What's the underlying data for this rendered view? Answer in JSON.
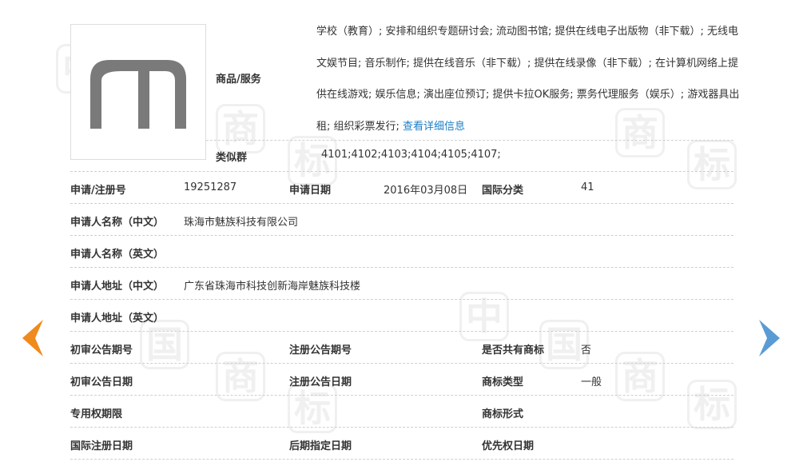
{
  "goods": {
    "label": "商品/服务",
    "text": "学校（教育）; 安排和组织专题研讨会; 流动图书馆; 提供在线电子出版物（非下载）; 无线电文娱节目; 音乐制作; 提供在线音乐（非下载）; 提供在线录像（非下载）; 在计算机网络上提供在线游戏; 娱乐信息; 演出座位预订; 提供卡拉OK服务; 票务代理服务（娱乐）; 游戏器具出租; 组织彩票发行;",
    "more_link": "查看详细信息"
  },
  "similar_group": {
    "label": "类似群",
    "value": "4101;4102;4103;4104;4105;4107;"
  },
  "reg_no": {
    "label": "申请/注册号",
    "value": "19251287"
  },
  "app_date": {
    "label": "申请日期",
    "value": "2016年03月08日"
  },
  "intl_class": {
    "label": "国际分类",
    "value": "41"
  },
  "applicant_cn": {
    "label": "申请人名称（中文）",
    "value": "珠海市魅族科技有限公司"
  },
  "applicant_en": {
    "label": "申请人名称（英文）",
    "value": ""
  },
  "address_cn": {
    "label": "申请人地址（中文）",
    "value": "广东省珠海市科技创新海岸魅族科技楼"
  },
  "address_en": {
    "label": "申请人地址（英文）",
    "value": ""
  },
  "prelim_pub_no": {
    "label": "初审公告期号",
    "value": ""
  },
  "reg_pub_no": {
    "label": "注册公告期号",
    "value": ""
  },
  "shared": {
    "label": "是否共有商标",
    "value": "否"
  },
  "prelim_pub_date": {
    "label": "初审公告日期",
    "value": ""
  },
  "reg_pub_date": {
    "label": "注册公告日期",
    "value": ""
  },
  "tm_type": {
    "label": "商标类型",
    "value": "一般"
  },
  "exclusive_period": {
    "label": "专用权期限",
    "value": ""
  },
  "tm_form": {
    "label": "商标形式",
    "value": ""
  },
  "intl_reg_date": {
    "label": "国际注册日期",
    "value": ""
  },
  "later_desig_date": {
    "label": "后期指定日期",
    "value": ""
  },
  "priority_date": {
    "label": "优先权日期",
    "value": ""
  },
  "watermark": {
    "char1": "中",
    "char2": "国",
    "char3": "商",
    "char4": "标"
  },
  "colors": {
    "prev_arrow": "#f08a1c",
    "next_arrow": "#5b9bd5",
    "link": "#1a7ec8",
    "logo": "#7a7a7a"
  },
  "icons": {
    "prev": "left-arrow-icon",
    "next": "right-arrow-icon"
  }
}
